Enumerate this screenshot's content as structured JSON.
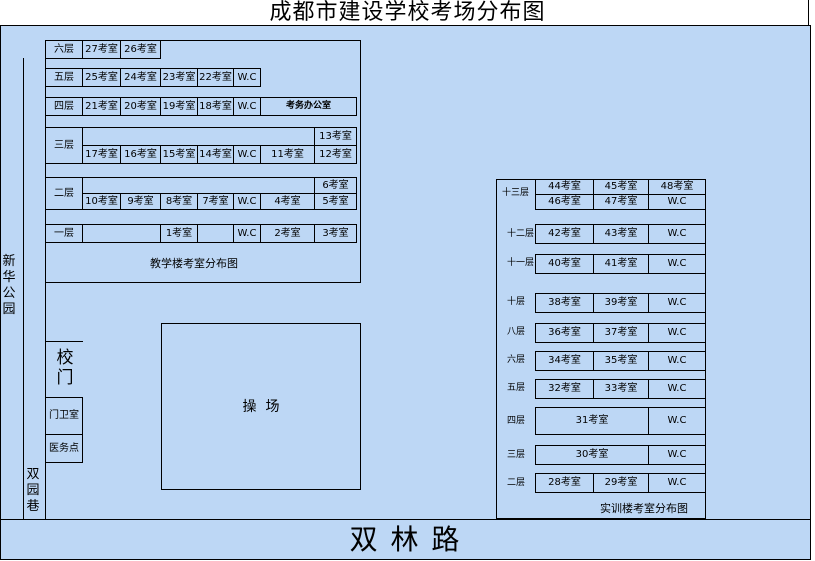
{
  "title": "成都市建设学校考场分布图",
  "colors": {
    "ground": "#bdd7f5",
    "frame": "#000000",
    "page": "#ffffff"
  },
  "road": "双 林 路",
  "park": "新华公园",
  "lane": "双园巷",
  "gate": "校门",
  "playground": "操  场",
  "guard_room": "门卫室",
  "clinic": "医务点",
  "teaching": {
    "caption": "教学楼考室分布图",
    "f6": {
      "floor": "六层",
      "rooms": [
        "27考室",
        "26考室"
      ]
    },
    "f5": {
      "floor": "五层",
      "rooms": [
        "25考室",
        "24考室",
        "23考室",
        "22考室"
      ],
      "wc": "W.C"
    },
    "f4": {
      "floor": "四层",
      "rooms": [
        "21考室",
        "20考室",
        "19考室",
        "18考室"
      ],
      "wc": "W.C",
      "office": "考务办公室"
    },
    "f3": {
      "floor": "三层",
      "rooms": [
        "17考室",
        "16考室",
        "15考室",
        "14考室"
      ],
      "wc": "W.C",
      "r11": "11考室",
      "top": "13考室",
      "bottom": "12考室"
    },
    "f2": {
      "floor": "二层",
      "rooms": [
        "10考室",
        "9考室",
        "8考室",
        "7考室"
      ],
      "wc": "W.C",
      "r4": "4考室",
      "top": "6考室",
      "bottom": "5考室"
    },
    "f1": {
      "floor": "一层",
      "r1": "1考室",
      "wc": "W.C",
      "r2": "2考室",
      "r3": "3考室"
    }
  },
  "training": {
    "caption": "实训楼考室分布图",
    "f13": {
      "floor": "十三层",
      "row1": [
        "44考室",
        "45考室",
        "48考室"
      ],
      "row2": [
        "46考室",
        "47考室",
        "W.C"
      ]
    },
    "f12": {
      "floor": "十二层",
      "rooms": [
        "42考室",
        "43考室"
      ],
      "wc": "W.C"
    },
    "f11": {
      "floor": "十一层",
      "rooms": [
        "40考室",
        "41考室"
      ],
      "wc": "W.C"
    },
    "f10": {
      "floor": "十层",
      "rooms": [
        "38考室",
        "39考室"
      ],
      "wc": "W.C"
    },
    "f8": {
      "floor": "八层",
      "rooms": [
        "36考室",
        "37考室"
      ],
      "wc": "W.C"
    },
    "f6": {
      "floor": "六层",
      "rooms": [
        "34考室",
        "35考室"
      ],
      "wc": "W.C"
    },
    "f5": {
      "floor": "五层",
      "rooms": [
        "32考室",
        "33考室"
      ],
      "wc": "W.C"
    },
    "f4": {
      "floor": "四层",
      "room": "31考室",
      "wc": "W.C"
    },
    "f3": {
      "floor": "三层",
      "room": "30考室",
      "wc": "W.C"
    },
    "f2": {
      "floor": "二层",
      "rooms": [
        "28考室",
        "29考室"
      ],
      "wc": "W.C"
    }
  }
}
